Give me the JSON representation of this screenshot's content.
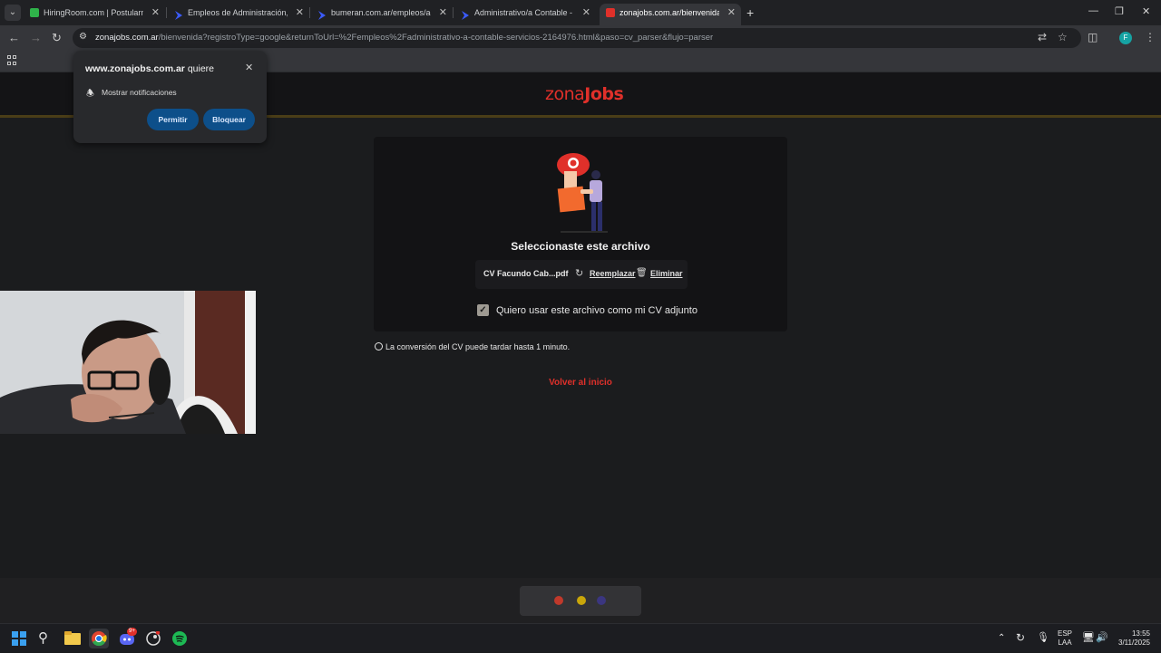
{
  "browser": {
    "tabs": [
      {
        "title": "HiringRoom.com | Postularme",
        "favicon_color": "#2fb34a",
        "active": false
      },
      {
        "title": "Empleos de Administración, Co",
        "favicon_color": "#3b5bff",
        "active": false
      },
      {
        "title": "bumeran.com.ar/empleos/adm",
        "favicon_color": "#3b5bff",
        "active": false
      },
      {
        "title": "Administrativo/a Contable - oc",
        "favicon_color": "#3b5bff",
        "active": false
      },
      {
        "title": "zonajobs.com.ar/bienvenida?re",
        "favicon_color": "#e0302a",
        "active": true
      }
    ],
    "url_domain": "zonajobs.com.ar",
    "url_path": "/bienvenida?registroType=google&returnToUrl=%2Fempleos%2Fadministrativo-a-contable-servicios-2164976.html&paso=cv_parser&flujo=parser",
    "profile_initial": "F"
  },
  "notification": {
    "site": "www.zonajobs.com.ar",
    "suffix": "quiere",
    "permission": "Mostrar notificaciones",
    "allow_label": "Permitir",
    "block_label": "Bloquear"
  },
  "page": {
    "logo_text_1": "zona",
    "logo_text_2": "Jobs",
    "brand_color": "#e0302a",
    "selected_title": "Seleccionaste este archivo",
    "file_name": "CV Facundo Cab...pdf",
    "replace_label": "Reemplazar",
    "delete_label": "Eliminar",
    "checkbox_label": "Quiero usar este archivo como mi CV adjunto",
    "checkbox_checked": true,
    "conversion_note": "La conversión del CV puede tardar hasta 1 minuto.",
    "back_link": "Volver al inicio"
  },
  "loader": {
    "dot_colors": [
      "#c0392b",
      "#c9a60a",
      "#3b3680"
    ]
  },
  "taskbar": {
    "language": "ESP",
    "layout": "LAA",
    "time": "13:55",
    "date": "3/11/2025",
    "discord_badge": "9+"
  }
}
